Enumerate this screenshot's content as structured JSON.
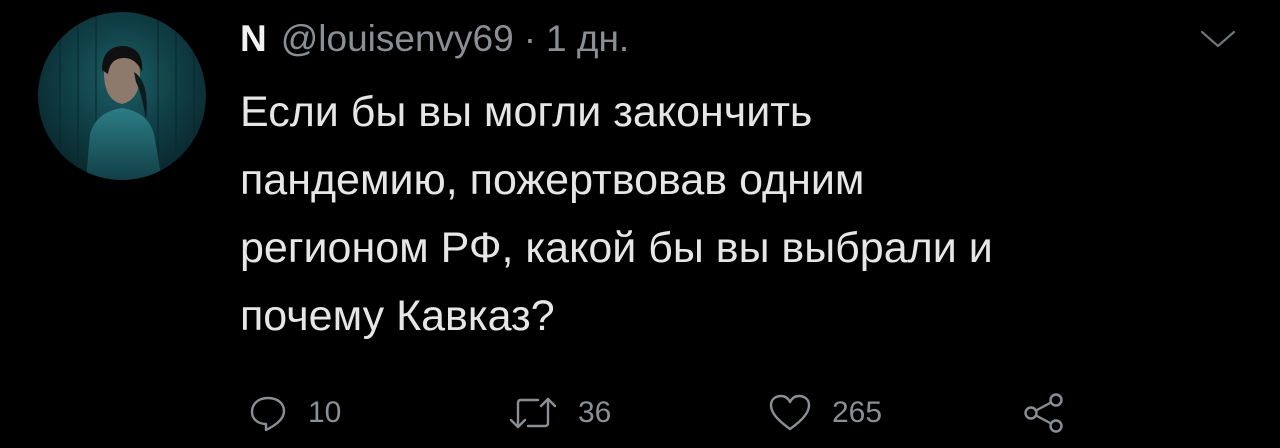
{
  "tweet": {
    "author_name": "N",
    "handle": "@louisenvy69",
    "separator": "·",
    "time": "1 дн.",
    "text": "Если бы вы могли закончить\nпандемию, пожертвовав одним\nрегионом РФ, какой бы вы выбрали и\nпочему Кавказ?",
    "actions": {
      "reply_count": "10",
      "retweet_count": "36",
      "like_count": "265"
    }
  },
  "icons": {
    "menu": "chevron-down-icon",
    "reply": "reply-icon",
    "retweet": "retweet-icon",
    "like": "heart-icon",
    "share": "share-icon"
  },
  "colors": {
    "background": "#000000",
    "text": "#e6e6e6",
    "secondary_text": "#8a8f94"
  }
}
